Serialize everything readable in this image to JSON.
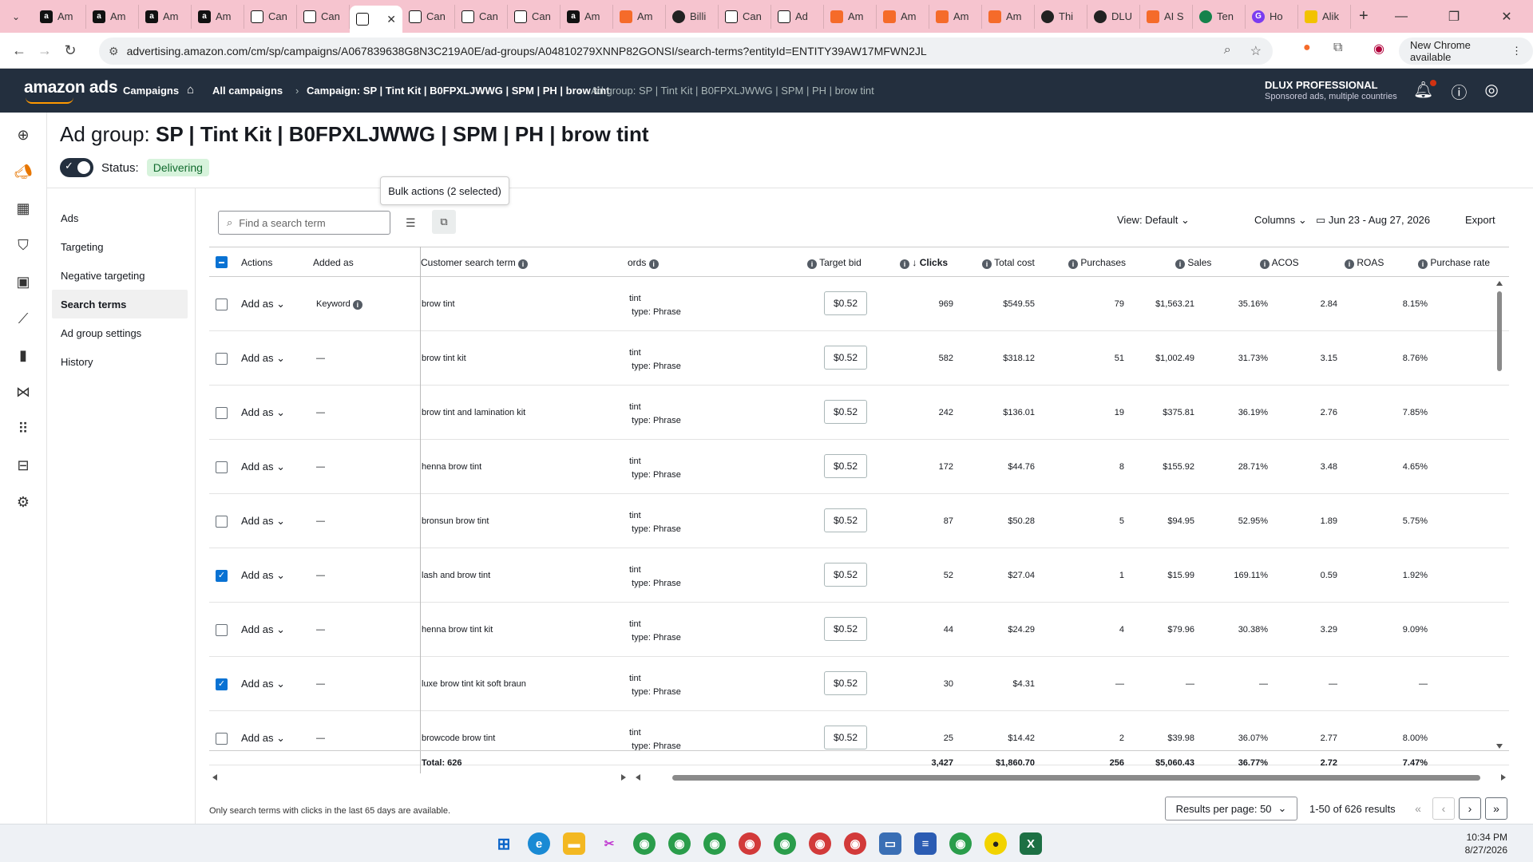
{
  "browser": {
    "tabs": [
      {
        "label": "Am",
        "icon": "amazon-icon"
      },
      {
        "label": "Am",
        "icon": "amazon-icon"
      },
      {
        "label": "Am",
        "icon": "amazon-icon"
      },
      {
        "label": "Am",
        "icon": "amazon-icon"
      },
      {
        "label": "Can",
        "icon": "mail-icon"
      },
      {
        "label": "Can",
        "icon": "mail-icon"
      },
      {
        "label": "",
        "icon": "mail-icon",
        "active": true
      },
      {
        "label": "Can",
        "icon": "mail-icon"
      },
      {
        "label": "Can",
        "icon": "mail-icon"
      },
      {
        "label": "Can",
        "icon": "mail-icon"
      },
      {
        "label": "Am",
        "icon": "amazon-icon"
      },
      {
        "label": "Am",
        "icon": "orange-icon"
      },
      {
        "label": "Billi",
        "icon": "book-icon"
      },
      {
        "label": "Can",
        "icon": "mail-icon"
      },
      {
        "label": "Ad",
        "icon": "mail-icon"
      },
      {
        "label": "Am",
        "icon": "orange-icon"
      },
      {
        "label": "Am",
        "icon": "orange-icon"
      },
      {
        "label": "Am",
        "icon": "orange-icon"
      },
      {
        "label": "Am",
        "icon": "orange-icon"
      },
      {
        "label": "Thi",
        "icon": "circle-icon"
      },
      {
        "label": "DLU",
        "icon": "circle-icon"
      },
      {
        "label": "AI S",
        "icon": "orange-icon"
      },
      {
        "label": "Ten",
        "icon": "green-icon"
      },
      {
        "label": "Ho",
        "icon": "purple-icon"
      },
      {
        "label": "Alik",
        "icon": "yellow-icon"
      }
    ],
    "url": "advertising.amazon.com/cm/sp/campaigns/A067839638G8N3C219A0E/ad-groups/A04810279XNNP82GONSI/search-terms?entityId=ENTITY39AW17MFWN2JL",
    "new_chrome": "New Chrome available"
  },
  "topnav": {
    "logo": "amazon ads",
    "campaigns": "Campaigns",
    "crumb1": "All campaigns",
    "crumb2": "Campaign: SP | Tint Kit | B0FPXLJWWG | SPM | PH | brow tint",
    "crumb3": "Ad group: SP | Tint Kit | B0FPXLJWWG | SPM | PH | brow tint",
    "account_name": "DLUX PROFESSIONAL",
    "account_sub": "Sponsored ads, multiple countries"
  },
  "page": {
    "title_prefix": "Ad group:",
    "title_name": "SP | Tint Kit | B0FPXLJWWG | SPM | PH | brow tint",
    "status_label": "Status:",
    "status_value": "Delivering"
  },
  "sidenav": [
    "Ads",
    "Targeting",
    "Negative targeting",
    "Search terms",
    "Ad group settings",
    "History"
  ],
  "toolbar": {
    "tooltip": "Bulk actions (2 selected)",
    "search_placeholder": "Find a search term",
    "view": "View: Default",
    "columns": "Columns",
    "date_range": "Jun 23 - Aug 27, 2026",
    "export": "Export"
  },
  "table": {
    "headers": {
      "actions": "Actions",
      "added_as": "Added as",
      "term": "Customer search term",
      "keywords": "ords",
      "target_bid": "Target bid",
      "clicks": "Clicks",
      "total_cost": "Total cost",
      "purchases": "Purchases",
      "sales": "Sales",
      "acos": "ACOS",
      "roas": "ROAS",
      "purchase_rate": "Purchase rate"
    },
    "rows": [
      {
        "checked": false,
        "add_as": "Add as",
        "added_as": "Keyword",
        "term": "brow tint",
        "kw": "tint",
        "match": "type: Phrase",
        "bid": "$0.52",
        "clicks": "969",
        "cost": "$549.55",
        "purchases": "79",
        "sales": "$1,563.21",
        "acos": "35.16%",
        "roas": "2.84",
        "rate": "8.15%"
      },
      {
        "checked": false,
        "add_as": "Add as",
        "added_as": "—",
        "term": "brow tint kit",
        "kw": "tint",
        "match": "type: Phrase",
        "bid": "$0.52",
        "clicks": "582",
        "cost": "$318.12",
        "purchases": "51",
        "sales": "$1,002.49",
        "acos": "31.73%",
        "roas": "3.15",
        "rate": "8.76%"
      },
      {
        "checked": false,
        "add_as": "Add as",
        "added_as": "—",
        "term": "brow tint and lamination kit",
        "kw": "tint",
        "match": "type: Phrase",
        "bid": "$0.52",
        "clicks": "242",
        "cost": "$136.01",
        "purchases": "19",
        "sales": "$375.81",
        "acos": "36.19%",
        "roas": "2.76",
        "rate": "7.85%"
      },
      {
        "checked": false,
        "add_as": "Add as",
        "added_as": "—",
        "term": "henna brow tint",
        "kw": "tint",
        "match": "type: Phrase",
        "bid": "$0.52",
        "clicks": "172",
        "cost": "$44.76",
        "purchases": "8",
        "sales": "$155.92",
        "acos": "28.71%",
        "roas": "3.48",
        "rate": "4.65%"
      },
      {
        "checked": false,
        "add_as": "Add as",
        "added_as": "—",
        "term": "bronsun brow tint",
        "kw": "tint",
        "match": "type: Phrase",
        "bid": "$0.52",
        "clicks": "87",
        "cost": "$50.28",
        "purchases": "5",
        "sales": "$94.95",
        "acos": "52.95%",
        "roas": "1.89",
        "rate": "5.75%"
      },
      {
        "checked": true,
        "add_as": "Add as",
        "added_as": "—",
        "term": "lash and brow tint",
        "kw": "tint",
        "match": "type: Phrase",
        "bid": "$0.52",
        "clicks": "52",
        "cost": "$27.04",
        "purchases": "1",
        "sales": "$15.99",
        "acos": "169.11%",
        "roas": "0.59",
        "rate": "1.92%"
      },
      {
        "checked": false,
        "add_as": "Add as",
        "added_as": "—",
        "term": "henna brow tint kit",
        "kw": "tint",
        "match": "type: Phrase",
        "bid": "$0.52",
        "clicks": "44",
        "cost": "$24.29",
        "purchases": "4",
        "sales": "$79.96",
        "acos": "30.38%",
        "roas": "3.29",
        "rate": "9.09%"
      },
      {
        "checked": true,
        "add_as": "Add as",
        "added_as": "—",
        "term": "luxe brow tint kit soft braun",
        "kw": "tint",
        "match": "type: Phrase",
        "bid": "$0.52",
        "clicks": "30",
        "cost": "$4.31",
        "purchases": "—",
        "sales": "—",
        "acos": "—",
        "roas": "—",
        "rate": "—"
      },
      {
        "checked": false,
        "add_as": "Add as",
        "added_as": "—",
        "term": "browcode brow tint",
        "kw": "tint",
        "match": "type: Phrase",
        "bid": "$0.52",
        "clicks": "25",
        "cost": "$14.42",
        "purchases": "2",
        "sales": "$39.98",
        "acos": "36.07%",
        "roas": "2.77",
        "rate": "8.00%"
      }
    ],
    "total": {
      "label": "Total: 626",
      "clicks": "3,427",
      "cost": "$1,860.70",
      "purchases": "256",
      "sales": "$5,060.43",
      "acos": "36.77%",
      "roas": "2.72",
      "rate": "7.47%"
    }
  },
  "footer": {
    "note": "Only search terms with clicks in the last 65 days are available.",
    "per_page": "Results per page: 50",
    "results": "1-50 of 626 results"
  },
  "taskbar": {
    "time": "10:34 PM",
    "date": "8/27/2026"
  }
}
